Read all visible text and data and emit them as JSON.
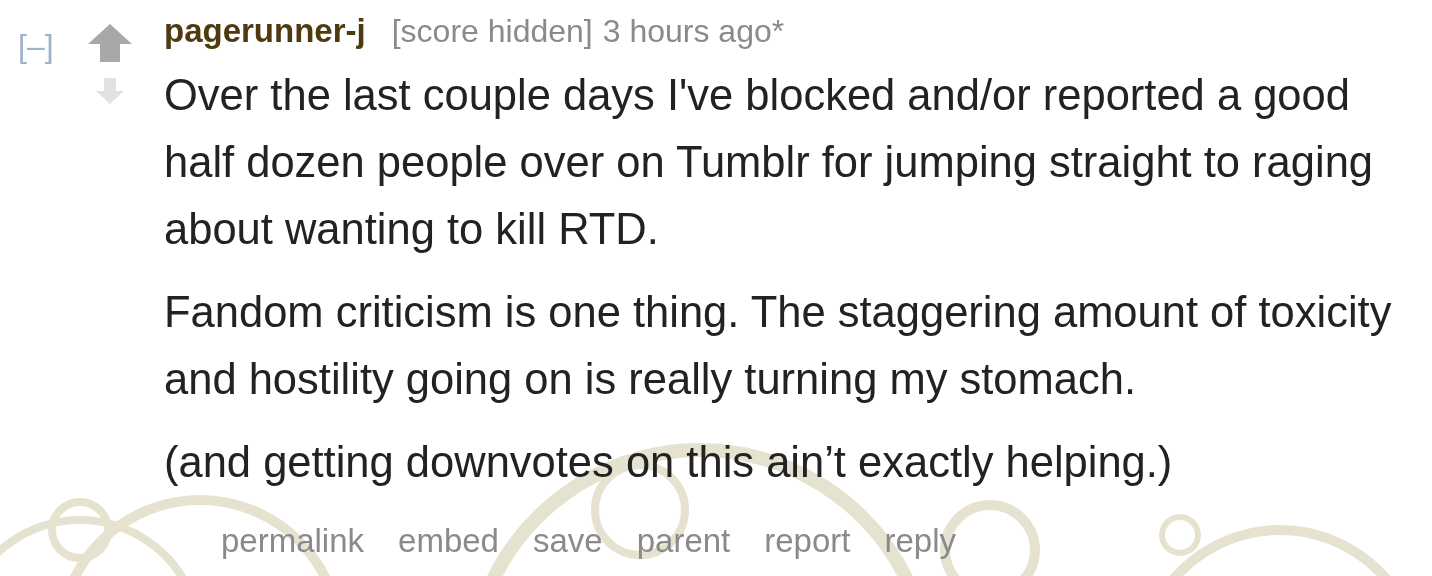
{
  "comment": {
    "collapse_toggle": "[–]",
    "author": "pagerunner-j",
    "score": "[score hidden]",
    "time": "3 hours ago*",
    "paragraphs": [
      "Over the last couple days I've blocked and/or reported a good half dozen people over on Tumblr for jumping straight to raging about wanting to kill RTD.",
      "Fandom criticism is one thing. The staggering amount of toxicity and hostility going on is really turning my stomach.",
      "(and getting downvotes on this ain’t exactly helping.)"
    ],
    "actions": [
      "permalink",
      "embed",
      "save",
      "parent",
      "report",
      "reply"
    ]
  }
}
